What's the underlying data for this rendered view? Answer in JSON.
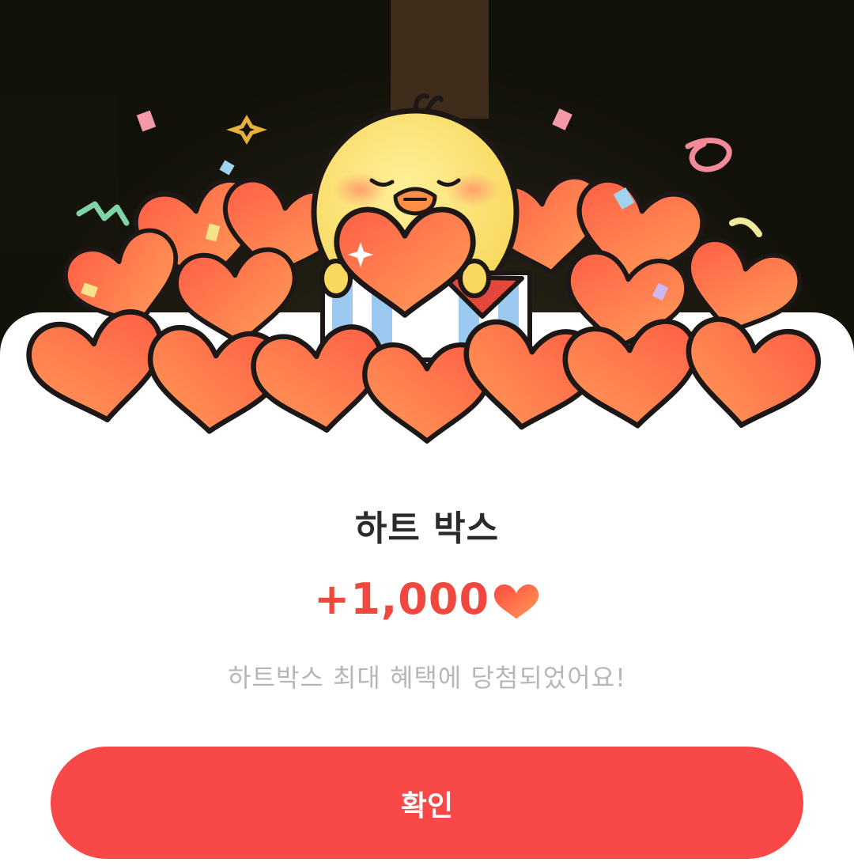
{
  "popup": {
    "title": "하트 박스",
    "reward_amount": "+1,000",
    "reward_icon": "heart-icon",
    "message": "하트박스 최대 혜택에 당첨되었어요!",
    "confirm_label": "확인"
  },
  "colors": {
    "accent": "#f94848",
    "reward_text": "#f0483f",
    "title_text": "#2b2b2b",
    "message_text": "#b7b7b7",
    "backdrop": "#14130c"
  }
}
